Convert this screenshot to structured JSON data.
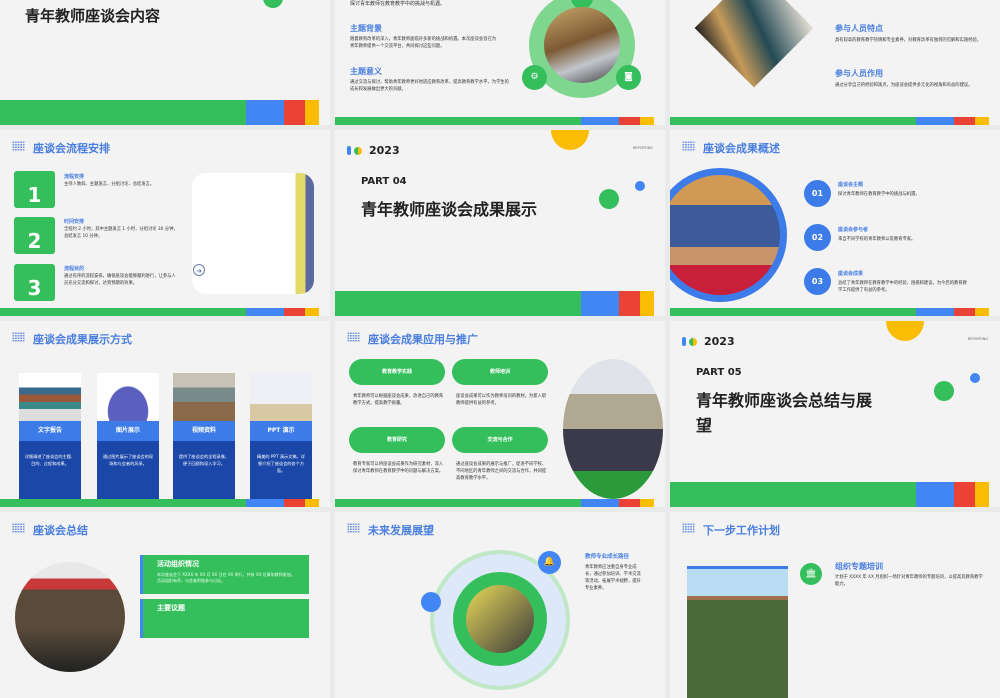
{
  "colors": {
    "green": "#35bf5c",
    "blue": "#4285f4",
    "red": "#ea4335",
    "yellow": "#fbbc04",
    "title_blue": "#4a7fe0"
  },
  "slides": {
    "contents": {
      "title": "青年教师座谈会内容"
    },
    "theme": {
      "top_text": "探讨青年教师在教育教学中的挑战与机遇。",
      "bg_label": "主题背景",
      "bg_text": "随着教育改革的深入，青年教师面临许多新的挑战和机遇。本次座谈会旨在为青年教师提供一个交流平台，共同探讨这些问题。",
      "sig_label": "主题意义",
      "sig_text": "通过交流与探讨，帮助青年教师更好地适应教育改革，提高教育教学水平，为学生的成长和发展做出更大的贡献。",
      "icons": [
        "gear-icon",
        "camera-icon"
      ]
    },
    "participants": {
      "feat_label": "参与人员特点",
      "feat_text": "具有较高的教育教学热情和专业素养，对教育改革有独到的见解和实践经验。",
      "role_label": "参与人员作用",
      "role_text": "通过分享自己的经验和观点，为座谈会提供多元化的视角和有益的建议。"
    },
    "process": {
      "title": "座谈会流程安排",
      "steps": [
        {
          "num": "1",
          "label": "流程安排",
          "text": "主持人致辞、主题发言、分组讨论、总结发言。"
        },
        {
          "num": "2",
          "label": "时间安排",
          "text": "全程约 2 小时，其中主题发言 1 小时，分组讨论 30 分钟，总结发言 10 分钟。"
        },
        {
          "num": "3",
          "label": "流程目的",
          "text": "通过有序的流程安排，确保座谈会能够顺利进行，让参与人员充分交流和探讨，达到预期的效果。"
        }
      ]
    },
    "part04": {
      "year": "2023",
      "reporting": "REPORTING",
      "part": "PART 04",
      "title": "青年教师座谈会成果展示"
    },
    "overview": {
      "title": "座谈会成果概述",
      "items": [
        {
          "num": "01",
          "label": "座谈会主题",
          "text": "探讨青年教师在教育教学中的挑战与机遇。"
        },
        {
          "num": "02",
          "label": "座谈会参与者",
          "text": "来自不同学校的青年教师以及教育专家。"
        },
        {
          "num": "03",
          "label": "座谈会成果",
          "text": "总结了青年教师在教育教学中的经验、困惑和建议，为今后的教育教学工作提供了有益的参考。"
        }
      ]
    },
    "display": {
      "title": "座谈会成果展示方式",
      "cards": [
        {
          "label": "文字报告",
          "text": "详细阐述了座谈会的主题、目的、过程和成果。"
        },
        {
          "label": "图片展示",
          "text": "通过图片展示了座谈会的现场和与会者的风采。"
        },
        {
          "label": "视频资料",
          "text": "提供了座谈会的全程录像，便于回顾和深入学习。"
        },
        {
          "label": "PPT 演示",
          "text": "精美的 PPT 演示文稿，详细介绍了座谈会的各个方面。"
        }
      ]
    },
    "application": {
      "title": "座谈会成果应用与推广",
      "items": [
        {
          "label": "教育教学实践",
          "text": "青年教师可以根据座谈会成果，改进自己的教育教学方式，提高教学质量。"
        },
        {
          "label": "教师培训",
          "text": "座谈会成果可以作为教师培训的教材，为新入职教师提供有益的参考。"
        },
        {
          "label": "教育研究",
          "text": "教育专家可以将座谈会成果作为研究素材，深入探讨青年教师在教育教学中的问题与解决方案。"
        },
        {
          "label": "交流与合作",
          "text": "通过座谈会成果的展示与推广，促进不同学校、不同地区的青年教师之间的交流与合作，共同提高教育教学水平。"
        }
      ]
    },
    "part05": {
      "year": "2023",
      "reporting": "REPORTING",
      "part": "PART 05",
      "title": "青年教师座谈会总结与展望"
    },
    "summary": {
      "title": "座谈会总结",
      "box1_title": "活动组织情况",
      "box1_text": "本次座谈会于 XXXX 年 XX 月 XX 日在 XX 举行，共有 XX 位青年教师参加。活动组织有序，与会者积极参与讨论。",
      "box2_title": "主要议题"
    },
    "future": {
      "title": "未来发展展望",
      "label": "教师专业成长路径",
      "text": "青年教师应注重自身专业成长，通过参加培训、学术交流等活动，拓展学术视野，提升专业素养。"
    },
    "plan": {
      "title": "下一步工作计划",
      "label": "组织专题培训",
      "text": "计划于 XXXX 年 XX 月组织一场针对青年教师的专题培训，以提高其教育教学能力。"
    }
  }
}
